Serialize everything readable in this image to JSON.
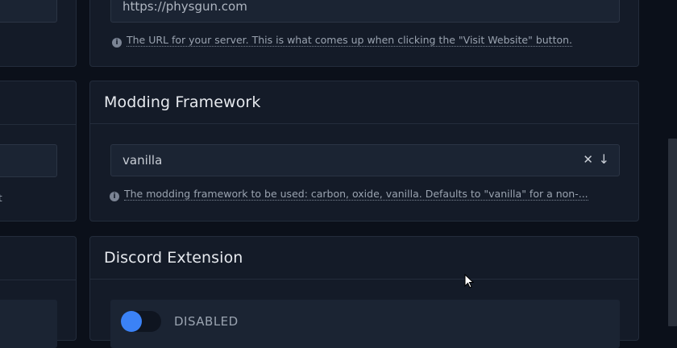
{
  "website": {
    "value": "https://physgun.com",
    "help": "The URL for your server. This is what comes up when clicking the \"Visit Website\" button."
  },
  "modding": {
    "title": "Modding Framework",
    "value": "vanilla",
    "clear_glyph": "✕",
    "arrow_glyph": "↓",
    "help": "The modding framework to be used: carbon, oxide, vanilla. Defaults to \"vanilla\" for a non-..."
  },
  "discord": {
    "title": "Discord Extension",
    "toggle_label": "DISABLED",
    "toggle_on": false,
    "accent": "#3b82f6"
  },
  "left_column": {
    "fragment": "t"
  },
  "icons": [
    "info-icon",
    "clear-icon",
    "arrow-down-icon",
    "cursor-icon"
  ]
}
